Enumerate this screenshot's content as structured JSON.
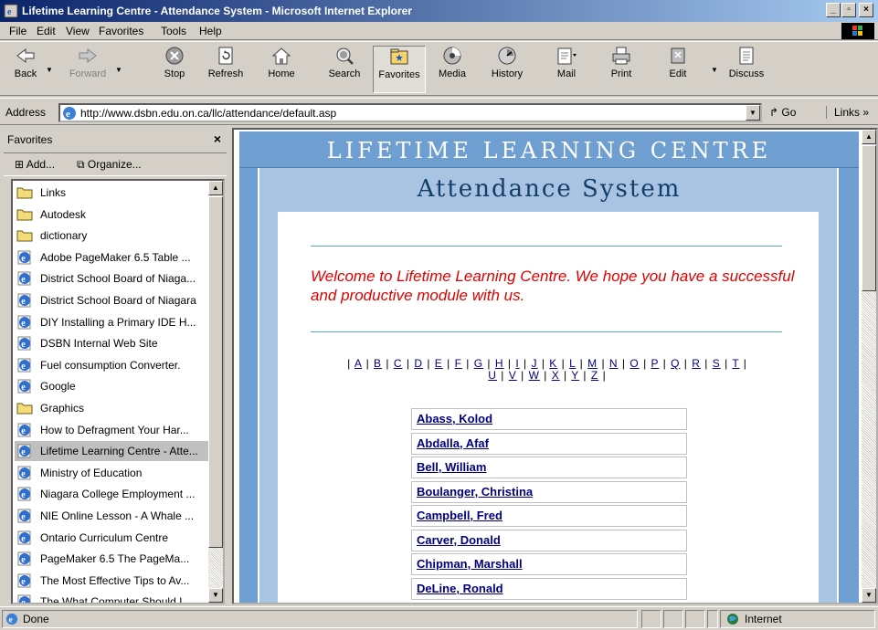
{
  "window": {
    "title": "Lifetime Learning Centre - Attendance System - Microsoft Internet Explorer"
  },
  "menu": [
    "File",
    "Edit",
    "View",
    "Favorites",
    "Tools",
    "Help"
  ],
  "toolbar": {
    "back": "Back",
    "forward": "Forward",
    "stop": "Stop",
    "refresh": "Refresh",
    "home": "Home",
    "search": "Search",
    "favorites": "Favorites",
    "media": "Media",
    "history": "History",
    "mail": "Mail",
    "print": "Print",
    "edit": "Edit",
    "discuss": "Discuss"
  },
  "address": {
    "label": "Address",
    "url": "http://www.dsbn.edu.on.ca/llc/attendance/default.asp",
    "go": "Go",
    "links": "Links"
  },
  "favorites_pane": {
    "title": "Favorites",
    "close": "×",
    "add": "Add...",
    "organize": "Organize...",
    "items": [
      {
        "label": "Links",
        "icon": "folder-icon"
      },
      {
        "label": "Autodesk",
        "icon": "folder-icon"
      },
      {
        "label": "dictionary",
        "icon": "folder-icon"
      },
      {
        "label": "Adobe PageMaker 6.5 Table ...",
        "icon": "ie-page-icon"
      },
      {
        "label": "District School Board of Niaga...",
        "icon": "ie-page-icon"
      },
      {
        "label": "District School Board of Niagara",
        "icon": "ie-page-icon"
      },
      {
        "label": "DIY Installing a Primary IDE H...",
        "icon": "ie-page-icon"
      },
      {
        "label": "DSBN Internal Web Site",
        "icon": "ie-page-icon"
      },
      {
        "label": "Fuel consumption Converter.",
        "icon": "ie-page-icon"
      },
      {
        "label": "Google",
        "icon": "ie-page-icon"
      },
      {
        "label": "Graphics",
        "icon": "folder-icon"
      },
      {
        "label": "How to Defragment Your Har...",
        "icon": "ie-page-icon"
      },
      {
        "label": "Lifetime Learning Centre - Atte...",
        "icon": "ie-page-icon"
      },
      {
        "label": "Ministry of Education",
        "icon": "ie-page-icon"
      },
      {
        "label": "Niagara College  Employment ...",
        "icon": "ie-page-icon"
      },
      {
        "label": "NIE Online Lesson - A Whale ...",
        "icon": "ie-page-icon"
      },
      {
        "label": "Ontario Curriculum Centre",
        "icon": "ie-page-icon"
      },
      {
        "label": "PageMaker 6.5 The PageMa...",
        "icon": "ie-page-icon"
      },
      {
        "label": "The Most Effective Tips to Av...",
        "icon": "ie-page-icon"
      },
      {
        "label": "The What Computer Should I ...",
        "icon": "ie-page-icon"
      }
    ],
    "selected_index": 12
  },
  "page": {
    "header": "LIFETIME LEARNING CENTRE",
    "subheader": "Attendance System",
    "welcome": "Welcome to Lifetime Learning Centre. We hope you have a successful and productive module with us.",
    "letters": [
      "A",
      "B",
      "C",
      "D",
      "E",
      "F",
      "G",
      "H",
      "I",
      "J",
      "K",
      "L",
      "M",
      "N",
      "O",
      "P",
      "Q",
      "R",
      "S",
      "T",
      "U",
      "V",
      "W",
      "X",
      "Y",
      "Z"
    ],
    "names": [
      "Abass, Kolod",
      "Abdalla, Afaf",
      "Bell, William",
      "Boulanger, Christina",
      "Campbell, Fred",
      "Carver, Donald",
      "Chipman, Marshall",
      "DeLine, Ronald"
    ]
  },
  "status": {
    "text": "Done",
    "zone": "Internet"
  },
  "colors": {
    "accent": "#0a246a",
    "page_blue": "#6699cc",
    "welcome_red": "#e00000",
    "link": "#000080"
  }
}
